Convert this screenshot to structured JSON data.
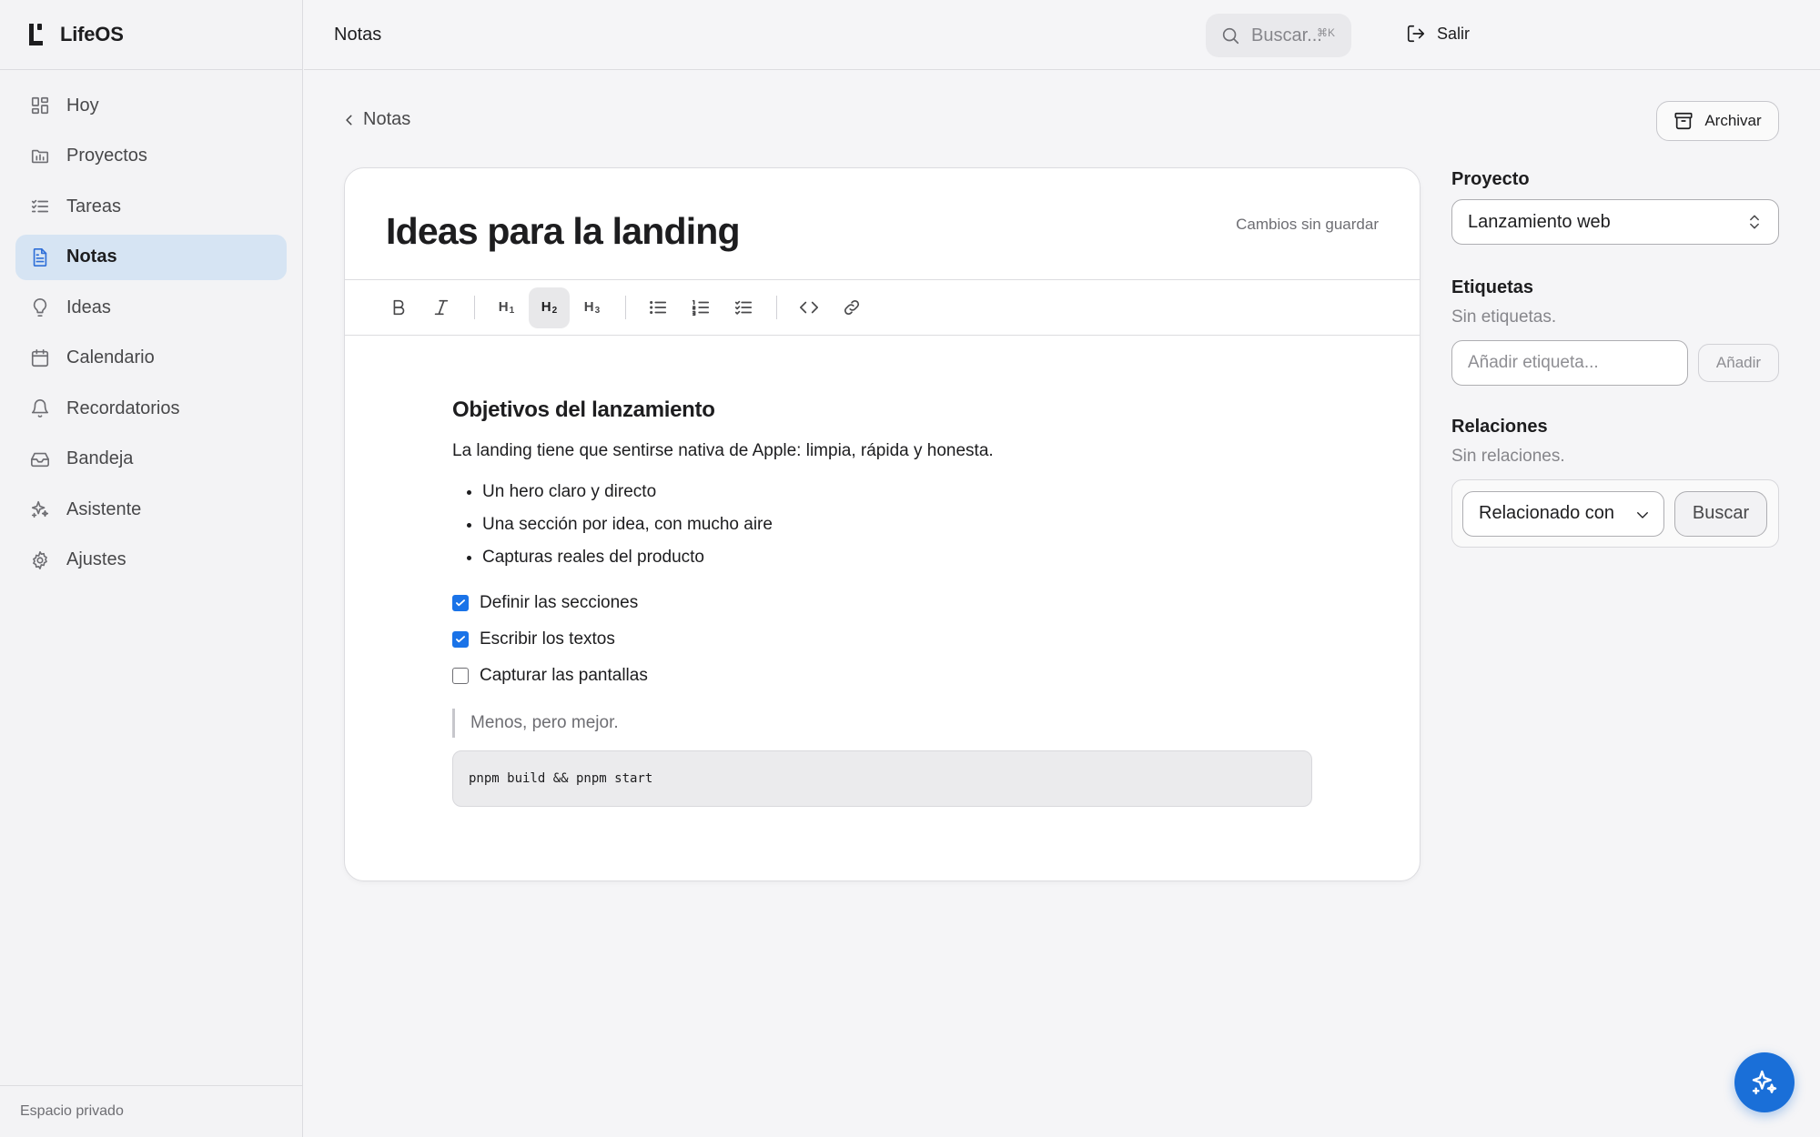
{
  "app": {
    "name": "LifeOS"
  },
  "sidebar": {
    "items": [
      {
        "label": "Hoy",
        "icon": "dashboard-icon",
        "active": false
      },
      {
        "label": "Proyectos",
        "icon": "folder-icon",
        "active": false
      },
      {
        "label": "Tareas",
        "icon": "checklist-icon",
        "active": false
      },
      {
        "label": "Notas",
        "icon": "document-icon",
        "active": true
      },
      {
        "label": "Ideas",
        "icon": "lightbulb-icon",
        "active": false
      },
      {
        "label": "Calendario",
        "icon": "calendar-icon",
        "active": false
      },
      {
        "label": "Recordatorios",
        "icon": "bell-icon",
        "active": false
      },
      {
        "label": "Bandeja",
        "icon": "inbox-icon",
        "active": false
      },
      {
        "label": "Asistente",
        "icon": "sparkles-icon",
        "active": false
      },
      {
        "label": "Ajustes",
        "icon": "gear-icon",
        "active": false
      }
    ],
    "footer": "Espacio privado"
  },
  "topbar": {
    "title": "Notas",
    "search_placeholder": "Buscar...",
    "search_shortcut": "⌘K",
    "logout_label": "Salir"
  },
  "main": {
    "back_label": "Notas",
    "archive_label": "Archivar"
  },
  "editor": {
    "title": "Ideas para la landing",
    "save_status": "Cambios sin guardar",
    "toolbar": [
      "bold",
      "italic",
      "h1",
      "h2",
      "h3",
      "bullet-list",
      "numbered-list",
      "task-list",
      "code",
      "link"
    ],
    "active_tool": "h2",
    "heading": "Objetivos del lanzamiento",
    "paragraph": "La landing tiene que sentirse nativa de Apple: limpia, rápida y honesta.",
    "bullets": [
      "Un hero claro y directo",
      "Una sección por idea, con mucho aire",
      "Capturas reales del producto"
    ],
    "tasks": [
      {
        "label": "Definir las secciones",
        "checked": true
      },
      {
        "label": "Escribir los textos",
        "checked": true
      },
      {
        "label": "Capturar las pantallas",
        "checked": false
      }
    ],
    "quote": "Menos, pero mejor.",
    "code": "pnpm build && pnpm start"
  },
  "panel": {
    "project_label": "Proyecto",
    "project_value": "Lanzamiento web",
    "tags_label": "Etiquetas",
    "tags_empty": "Sin etiquetas.",
    "tag_input_placeholder": "Añadir etiqueta...",
    "tag_add_label": "Añadir",
    "relations_label": "Relaciones",
    "relations_empty": "Sin relaciones.",
    "relation_type": "Relacionado con",
    "relation_search_label": "Buscar"
  },
  "colors": {
    "accent": "#1a73e8",
    "active_nav_bg": "#d6e4f3",
    "fab": "#1a6fd8"
  }
}
